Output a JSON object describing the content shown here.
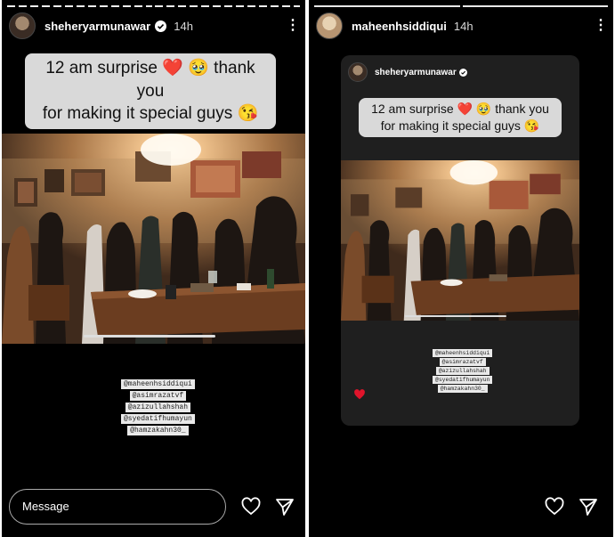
{
  "left_story": {
    "username": "sheheryarmunawar",
    "time": "14h",
    "menu": "⋮",
    "caption_line1_text": "12 am surprise",
    "caption_heart": "❤️",
    "caption_line1_tail": "🥹 thank you",
    "caption_line2": "for making it special guys 😘",
    "tags": [
      "@maheenhsiddiqui",
      "@asimrazatvf",
      "@azizullahshah",
      "@syedatifhumayun",
      "@hamzakahn30_"
    ],
    "message_placeholder": "Message"
  },
  "right_story": {
    "username": "maheenhsiddiqui",
    "time": "14h",
    "menu": "⋮",
    "shared_username": "sheheryarmunawar",
    "caption_line1_text": "12 am surprise",
    "caption_heart": "❤️",
    "caption_line1_tail": "🥹 thank you",
    "caption_line2": "for making it special guys 😘",
    "tags": [
      "@maheenhsiddiqui",
      "@asimrazatvf",
      "@azizullahshah",
      "@syedatifhumayun",
      "@hamzakahn30_"
    ]
  },
  "icons": {
    "verified": "verified-badge-icon",
    "like": "heart-icon",
    "send": "paper-plane-icon",
    "sticker_heart": "red-heart-icon"
  },
  "colors": {
    "background": "#000000",
    "caption_bg": "#d9d9d9",
    "heart": "#e0142b",
    "verified": "#ffffff"
  }
}
